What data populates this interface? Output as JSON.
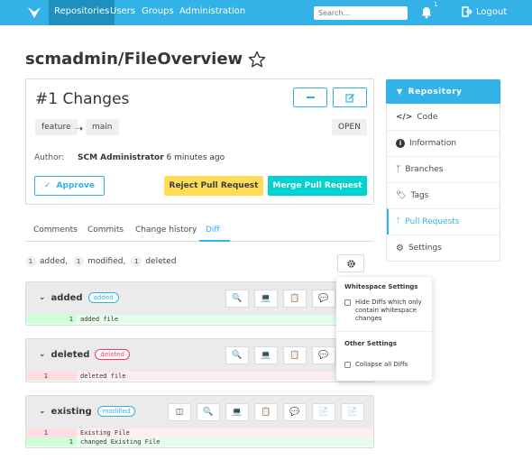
{
  "nav": {
    "items": [
      "Repositories",
      "Users",
      "Groups",
      "Administration"
    ],
    "search_placeholder": "Search...",
    "notification_count": "1",
    "logout": "Logout"
  },
  "page": {
    "title": "scmadmin/FileOverview"
  },
  "pr": {
    "title": "#1 Changes",
    "source_branch": "feature",
    "target_branch": "main",
    "status": "OPEN",
    "author_label": "Author:",
    "author_name": "SCM Administrator",
    "author_time": "6 minutes ago",
    "approve": "Approve",
    "reject": "Reject Pull Request",
    "merge": "Merge Pull Request"
  },
  "tabs": [
    "Comments",
    "Commits",
    "Change history",
    "Diff"
  ],
  "summary": {
    "added_count": "1",
    "added_label": "added,",
    "modified_count": "1",
    "modified_label": "modified,",
    "deleted_count": "1",
    "deleted_label": "deleted"
  },
  "files": [
    {
      "name": "added",
      "badge": "added",
      "lines": [
        {
          "old": "",
          "new": "1",
          "text": "added file",
          "kind": "added"
        }
      ]
    },
    {
      "name": "deleted",
      "badge": "deleted",
      "lines": [
        {
          "old": "1",
          "new": "",
          "text": "deleted file",
          "kind": "deleted"
        }
      ]
    },
    {
      "name": "existing",
      "badge": "modified",
      "lines": [
        {
          "old": "1",
          "new": "",
          "text": "Existing File",
          "kind": "deleted"
        },
        {
          "old": "",
          "new": "1",
          "text": "changed Existing File",
          "kind": "added"
        }
      ]
    }
  ],
  "sidebar": {
    "header": "Repository",
    "items": [
      "Code",
      "Information",
      "Branches",
      "Tags",
      "Pull Requests",
      "Settings"
    ]
  },
  "popover": {
    "whitespace_title": "Whitespace Settings",
    "hide_diffs": "Hide Diffs which only contain whitespace changes",
    "other_title": "Other Settings",
    "collapse": "Collapse all Diffs"
  },
  "colors": {
    "primary": "#33b2e8",
    "warning": "#ffdd57",
    "success": "#00d1d1",
    "danger": "#ff3860"
  }
}
